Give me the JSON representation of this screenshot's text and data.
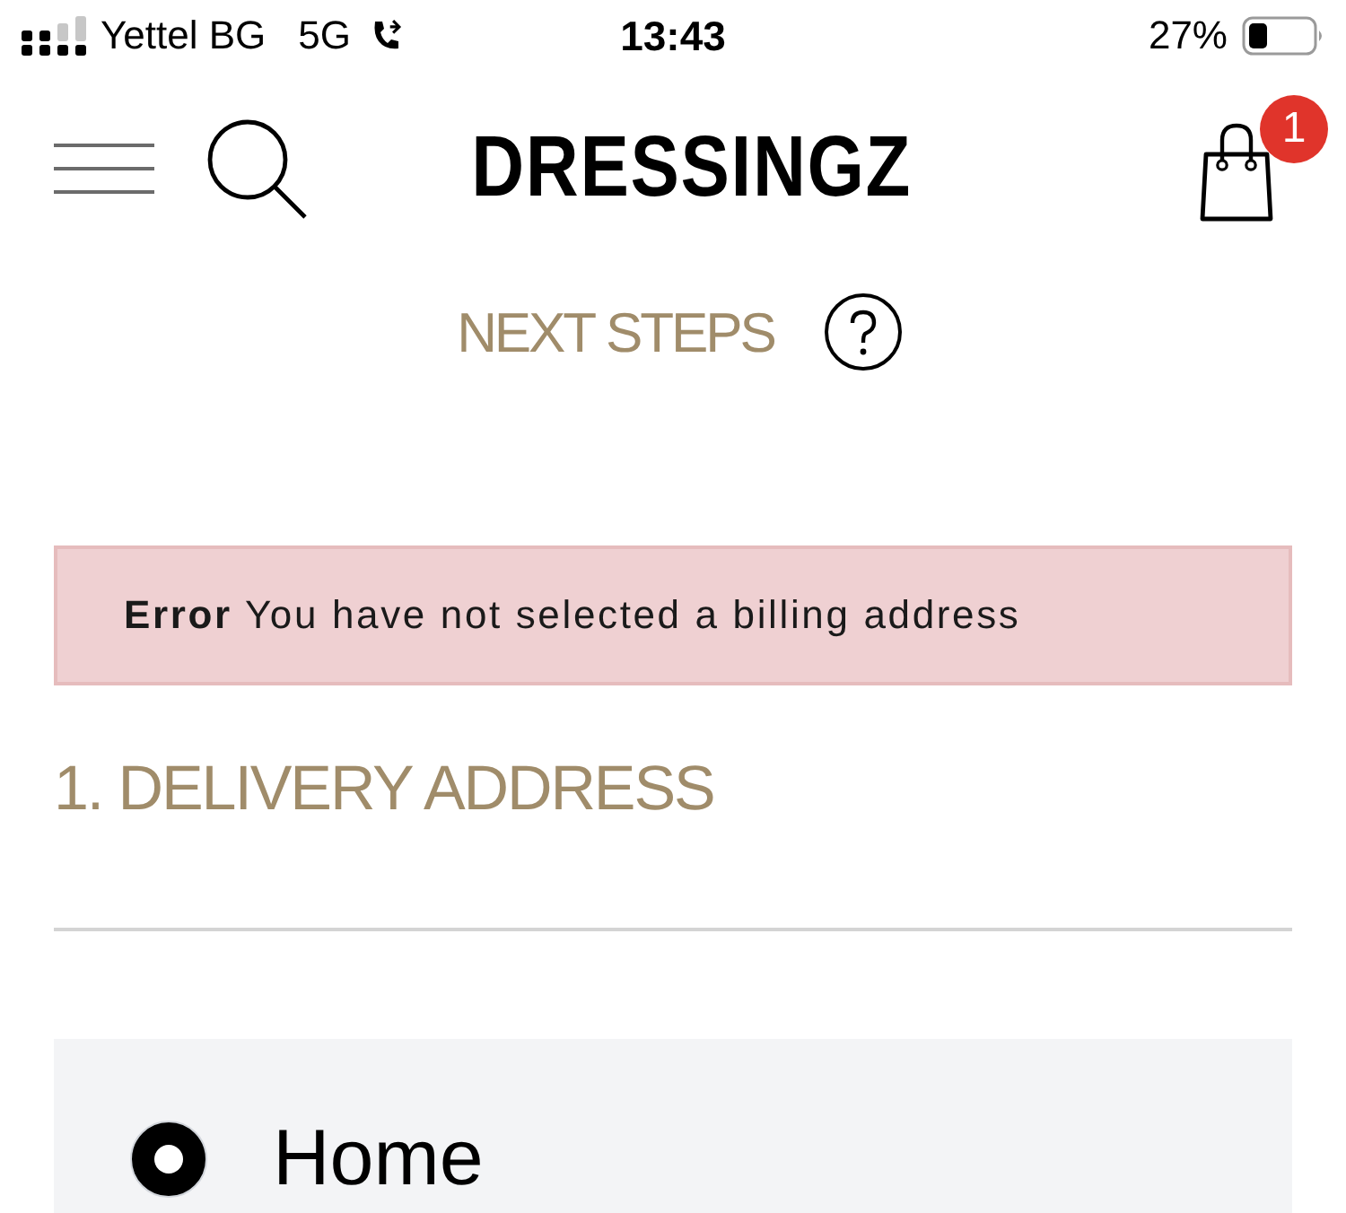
{
  "status_bar": {
    "carrier": "Yettel BG",
    "network": "5G",
    "time": "13:43",
    "battery": "27%"
  },
  "header": {
    "logo": "DRESSINGZ",
    "cart_count": "1"
  },
  "page_title": "NEXT STEPS",
  "error": {
    "label": "Error",
    "message": "You have not selected a billing address"
  },
  "section_title": "1. DELIVERY ADDRESS",
  "addresses": [
    {
      "label": "Home",
      "selected": true
    }
  ]
}
